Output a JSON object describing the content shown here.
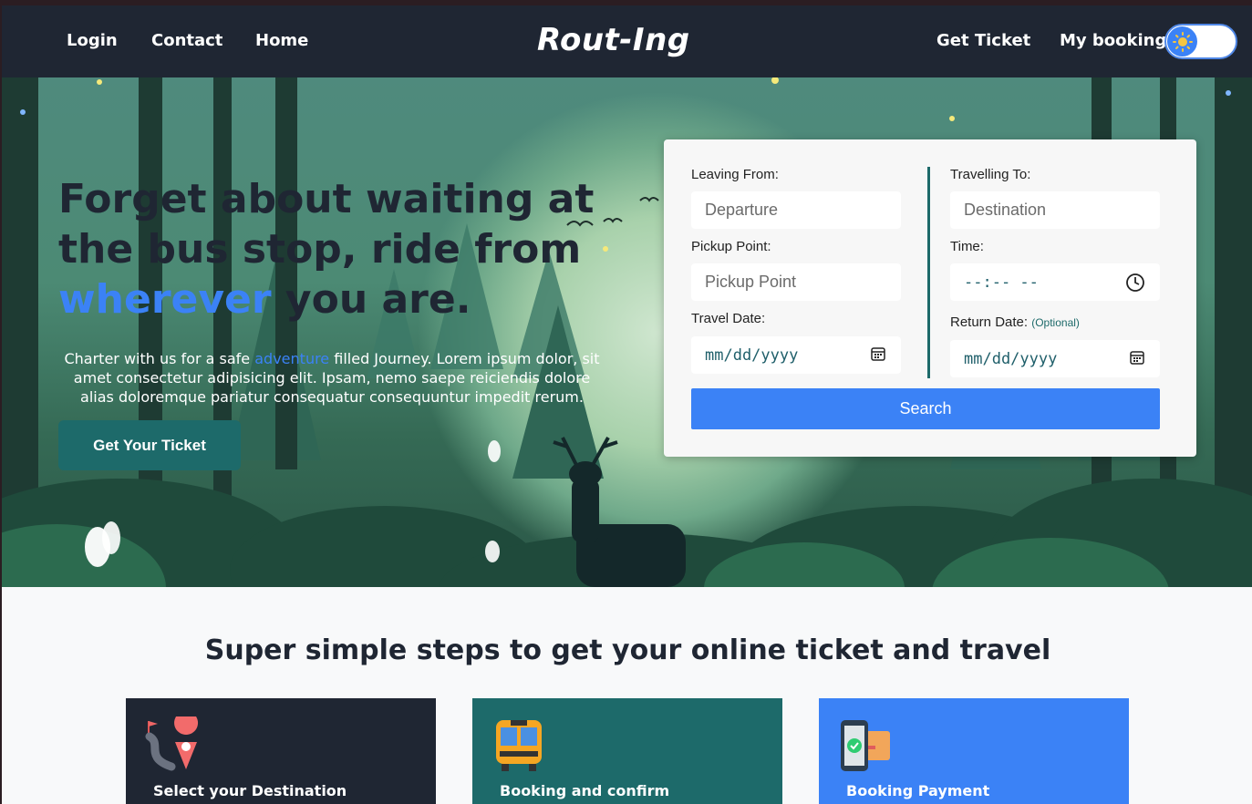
{
  "nav": {
    "links_left": [
      "Login",
      "Contact",
      "Home"
    ],
    "logo": "Rout-Ing",
    "links_right": [
      "Get Ticket",
      "My booking"
    ],
    "theme_toggle_icon": "sun-icon"
  },
  "hero": {
    "headline_part1": "Forget about waiting at the bus stop, ride from",
    "headline_accent": "wherever",
    "headline_part2": "you are.",
    "sub_part1": "Charter with us for a safe",
    "sub_accent": "adventure",
    "sub_part2": "filled Journey. Lorem ipsum dolor, sit amet consectetur adipisicing elit. Ipsam, nemo saepe reiciendis dolore alias doloremque pariatur consequatur consequuntur impedit rerum.",
    "cta_label": "Get Your Ticket"
  },
  "form": {
    "leaving_label": "Leaving From:",
    "leaving_placeholder": "Departure",
    "travelling_label": "Travelling To:",
    "travelling_placeholder": "Destination",
    "pickup_label": "Pickup Point:",
    "pickup_placeholder": "Pickup Point",
    "time_label": "Time:",
    "time_value": "--:-- --",
    "travel_date_label": "Travel Date:",
    "travel_date_value": "mm/dd/yyyy",
    "return_label": "Return Date:",
    "return_optional": "(Optional)",
    "return_date_value": "mm/dd/yyyy",
    "search_label": "Search"
  },
  "steps": {
    "title": "Super simple steps to get your online ticket and travel",
    "cards": [
      {
        "title": "Select your Destination",
        "icon": "map-pin-route-icon",
        "color": "#1f2633"
      },
      {
        "title": "Booking and confirm",
        "icon": "bus-icon",
        "color": "#1d6a6a"
      },
      {
        "title": "Booking Payment",
        "icon": "phone-payment-icon",
        "color": "#3b82f6"
      }
    ]
  },
  "colors": {
    "nav_bg": "#1f2633",
    "accent_blue": "#3b82f6",
    "teal": "#1d6a6a"
  }
}
